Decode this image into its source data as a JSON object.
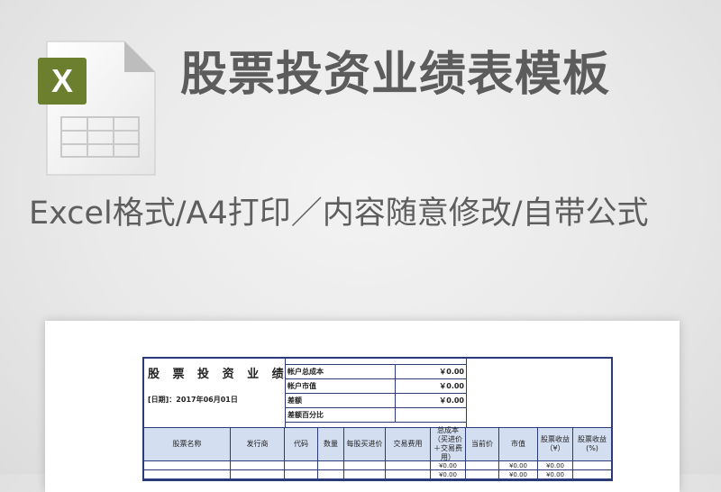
{
  "banner": {
    "title": "股票投资业绩表模板",
    "subtitle": "Excel格式/A4打印／内容随意修改/自带公式",
    "icon": "excel-file-icon",
    "icon_letter": "X",
    "accent": "#6b7f2e"
  },
  "sheet": {
    "title": "股 票 投 资 业 绩",
    "date": "[日期]：2017年06月01日",
    "summary": [
      {
        "label": "帐户总成本",
        "value": "￥0.00"
      },
      {
        "label": "帐户市值",
        "value": "￥0.00"
      },
      {
        "label": "差额",
        "value": "￥0.00"
      },
      {
        "label": "差额百分比",
        "value": ""
      }
    ],
    "columns": [
      "股票名称",
      "发行商",
      "代码",
      "数量",
      "每股买进价",
      "交易费用",
      "总成本（买进价＋交易费用）",
      "当前价",
      "市值",
      "股票收益（¥）",
      "股票收益(%)"
    ],
    "rows": [
      [
        "",
        "",
        "",
        "",
        "",
        "",
        "¥0.00",
        "",
        "¥0.00",
        "¥0.00",
        ""
      ],
      [
        "",
        "",
        "",
        "",
        "",
        "",
        "¥0.00",
        "",
        "¥0.00",
        "¥0.00",
        ""
      ]
    ],
    "header_color": "#d3def1",
    "border_color": "#2b3a78"
  }
}
